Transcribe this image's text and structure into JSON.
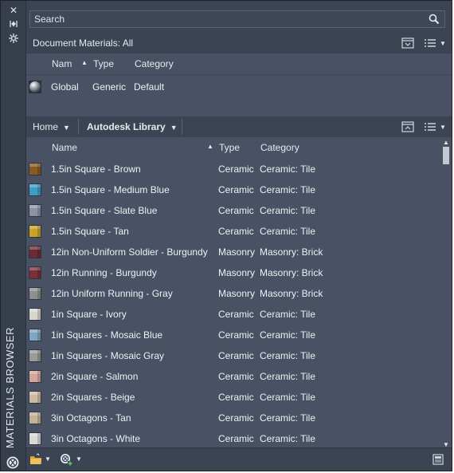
{
  "window": {
    "vertical_title": "MATERIALS BROWSER",
    "controls": [
      "close-icon",
      "autohide-icon",
      "properties-icon"
    ]
  },
  "search": {
    "placeholder": "Search"
  },
  "document_materials": {
    "title": "Document Materials: All",
    "columns": {
      "name": "Nam",
      "type": "Type",
      "category": "Category"
    },
    "rows": [
      {
        "name": "Global",
        "type": "Generic",
        "category": "Default",
        "swatch": "#9aa0a8"
      }
    ]
  },
  "library": {
    "nav": {
      "home": "Home",
      "library": "Autodesk Library"
    },
    "columns": {
      "name": "Name",
      "type": "Type",
      "category": "Category"
    },
    "rows": [
      {
        "name": "1.5in Square - Brown",
        "type": "Ceramic",
        "category": "Ceramic: Tile",
        "swatch": "#8a5a23"
      },
      {
        "name": "1.5in Square - Medium Blue",
        "type": "Ceramic",
        "category": "Ceramic: Tile",
        "swatch": "#3a9fc4"
      },
      {
        "name": "1.5in Square - Slate Blue",
        "type": "Ceramic",
        "category": "Ceramic: Tile",
        "swatch": "#8c92a8"
      },
      {
        "name": "1.5in Square - Tan",
        "type": "Ceramic",
        "category": "Ceramic: Tile",
        "swatch": "#c9a227"
      },
      {
        "name": "12in Non-Uniform Soldier - Burgundy",
        "type": "Masonry",
        "category": "Masonry: Brick",
        "swatch": "#6e2a34"
      },
      {
        "name": "12in Running - Burgundy",
        "type": "Masonry",
        "category": "Masonry: Brick",
        "swatch": "#7a2f38"
      },
      {
        "name": "12in Uniform Running - Gray",
        "type": "Masonry",
        "category": "Masonry: Brick",
        "swatch": "#8e8e8e"
      },
      {
        "name": "1in Square - Ivory",
        "type": "Ceramic",
        "category": "Ceramic: Tile",
        "swatch": "#d9d6cc"
      },
      {
        "name": "1in Squares - Mosaic Blue",
        "type": "Ceramic",
        "category": "Ceramic: Tile",
        "swatch": "#7fa5c2"
      },
      {
        "name": "1in Squares - Mosaic Gray",
        "type": "Ceramic",
        "category": "Ceramic: Tile",
        "swatch": "#9a9a9a"
      },
      {
        "name": "2in Square - Salmon",
        "type": "Ceramic",
        "category": "Ceramic: Tile",
        "swatch": "#d4a79a"
      },
      {
        "name": "2in Squares - Beige",
        "type": "Ceramic",
        "category": "Ceramic: Tile",
        "swatch": "#cbbba3"
      },
      {
        "name": "3in Octagons - Tan",
        "type": "Ceramic",
        "category": "Ceramic: Tile",
        "swatch": "#c4b196"
      },
      {
        "name": "3in Octagons - White",
        "type": "Ceramic",
        "category": "Ceramic: Tile",
        "swatch": "#d8d8d8"
      }
    ]
  },
  "footer": {
    "icons": [
      "open-library-icon",
      "create-material-icon",
      "material-editor-icon"
    ]
  }
}
